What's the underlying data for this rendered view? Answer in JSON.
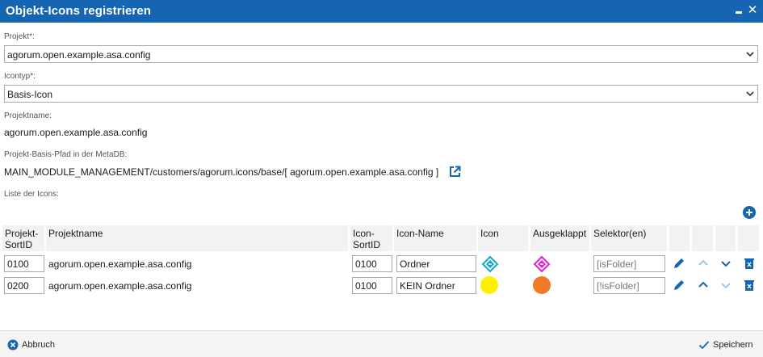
{
  "window": {
    "title": "Objekt-Icons registrieren",
    "minimize_icon": "minimize-icon",
    "close_icon": "close-icon"
  },
  "form": {
    "project_label": "Projekt*:",
    "project_value": "agorum.open.example.asa.config",
    "icontype_label": "Icontyp*:",
    "icontype_value": "Basis-Icon",
    "projectname_label": "Projektname:",
    "projectname_value": "agorum.open.example.asa.config",
    "basepath_label": "Projekt-Basis-Pfad in der MetaDB:",
    "basepath_value": "MAIN_MODULE_MANAGEMENT/customers/agorum.icons/base/[ agorum.open.example.asa.config ]",
    "icons_list_label": "Liste der Icons:"
  },
  "table": {
    "headers": {
      "sortid_line1": "Projekt-",
      "sortid_line2": "SortID",
      "projectname": "Projektname",
      "icon_sortid_line1": "Icon-",
      "icon_sortid_line2": "SortID",
      "icon_name": "Icon-Name",
      "icon": "Icon",
      "expanded": "Ausgeklappt",
      "selectors": "Selektor(en)"
    },
    "rows": [
      {
        "project_sortid": "0100",
        "projectname": "agorum.open.example.asa.config",
        "icon_sortid": "0100",
        "icon_name": "Ordner",
        "icon": "folder-diamond-icon",
        "icon_color": "#13a7c7",
        "expanded": "folder-diamond-open-icon",
        "expanded_color": "#e020d8",
        "selector": "[isFolder]",
        "up_enabled": false,
        "down_enabled": true
      },
      {
        "project_sortid": "0200",
        "projectname": "agorum.open.example.asa.config",
        "icon_sortid": "0100",
        "icon_name": "KEIN Ordner",
        "icon": "yellow-circle-icon",
        "icon_color": "#ffef00",
        "expanded": "orange-circle-icon",
        "expanded_color": "#f07a28",
        "selector": "[!isFolder]",
        "up_enabled": true,
        "down_enabled": false
      }
    ]
  },
  "footer": {
    "cancel_label": "Abbruch",
    "save_label": "Speichern"
  },
  "colors": {
    "accent": "#1565b2",
    "titlebar": "#1565b2",
    "delete": "#1565b2"
  }
}
